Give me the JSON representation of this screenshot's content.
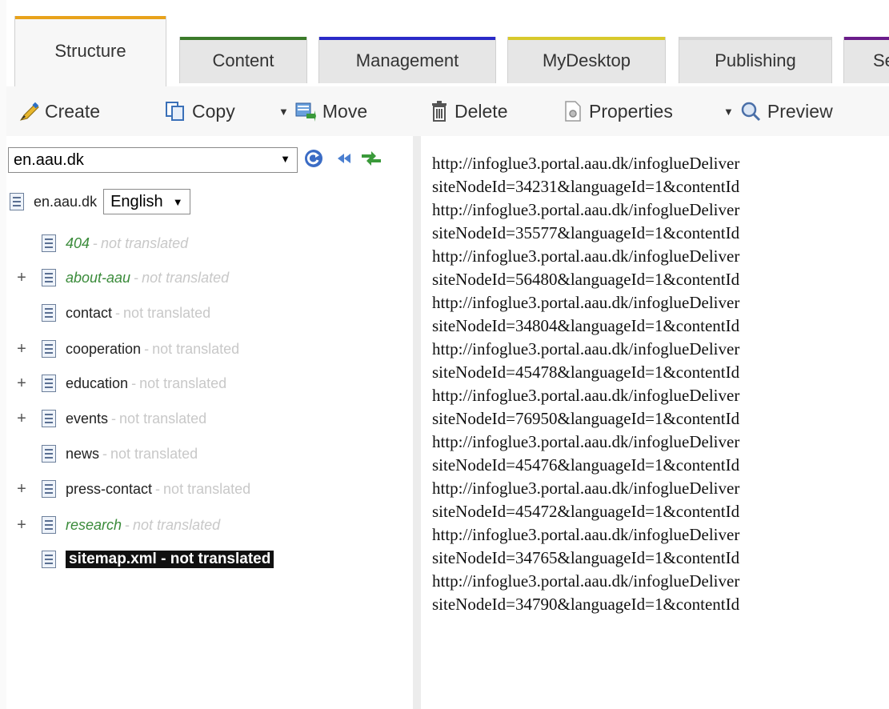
{
  "tabs": [
    {
      "label": "Structure",
      "color": "#e8a21b",
      "active": true
    },
    {
      "label": "Content",
      "color": "#3b7a2a",
      "active": false
    },
    {
      "label": "Management",
      "color": "#2a2ac8",
      "active": false
    },
    {
      "label": "MyDesktop",
      "color": "#d8c92c",
      "active": false
    },
    {
      "label": "Publishing",
      "color": "#d6d6d6",
      "active": false
    },
    {
      "label": "Se",
      "color": "#6a1c8a",
      "active": false
    }
  ],
  "toolbar": {
    "create": "Create",
    "copy": "Copy",
    "move": "Move",
    "delete": "Delete",
    "properties": "Properties",
    "preview": "Preview"
  },
  "site_select": {
    "value": "en.aau.dk"
  },
  "tree": {
    "root": {
      "name": "en.aau.dk",
      "language": "English"
    },
    "not_translated": "not translated",
    "sep": "-",
    "items": [
      {
        "name": "404",
        "expandable": false,
        "green": true
      },
      {
        "name": "about-aau",
        "expandable": true,
        "green": true
      },
      {
        "name": "contact",
        "expandable": false,
        "green": false
      },
      {
        "name": "cooperation",
        "expandable": true,
        "green": false
      },
      {
        "name": "education",
        "expandable": true,
        "green": false
      },
      {
        "name": "events",
        "expandable": true,
        "green": false
      },
      {
        "name": "news",
        "expandable": false,
        "green": false
      },
      {
        "name": "press-contact",
        "expandable": true,
        "green": false
      },
      {
        "name": "research",
        "expandable": true,
        "green": true
      },
      {
        "name": "sitemap.xml",
        "expandable": false,
        "selected": true
      }
    ]
  },
  "content_lines": [
    "http://infoglue3.portal.aau.dk/infoglueDeliver",
    "siteNodeId=34231&languageId=1&contentId",
    "http://infoglue3.portal.aau.dk/infoglueDeliver",
    "siteNodeId=35577&languageId=1&contentId",
    "http://infoglue3.portal.aau.dk/infoglueDeliver",
    "siteNodeId=56480&languageId=1&contentId",
    "http://infoglue3.portal.aau.dk/infoglueDeliver",
    "siteNodeId=34804&languageId=1&contentId",
    "http://infoglue3.portal.aau.dk/infoglueDeliver",
    "siteNodeId=45478&languageId=1&contentId",
    "http://infoglue3.portal.aau.dk/infoglueDeliver",
    "siteNodeId=76950&languageId=1&contentId",
    "http://infoglue3.portal.aau.dk/infoglueDeliver",
    "siteNodeId=45476&languageId=1&contentId",
    "http://infoglue3.portal.aau.dk/infoglueDeliver",
    "siteNodeId=45472&languageId=1&contentId",
    "http://infoglue3.portal.aau.dk/infoglueDeliver",
    "siteNodeId=34765&languageId=1&contentId",
    "http://infoglue3.portal.aau.dk/infoglueDeliver",
    "siteNodeId=34790&languageId=1&contentId"
  ]
}
